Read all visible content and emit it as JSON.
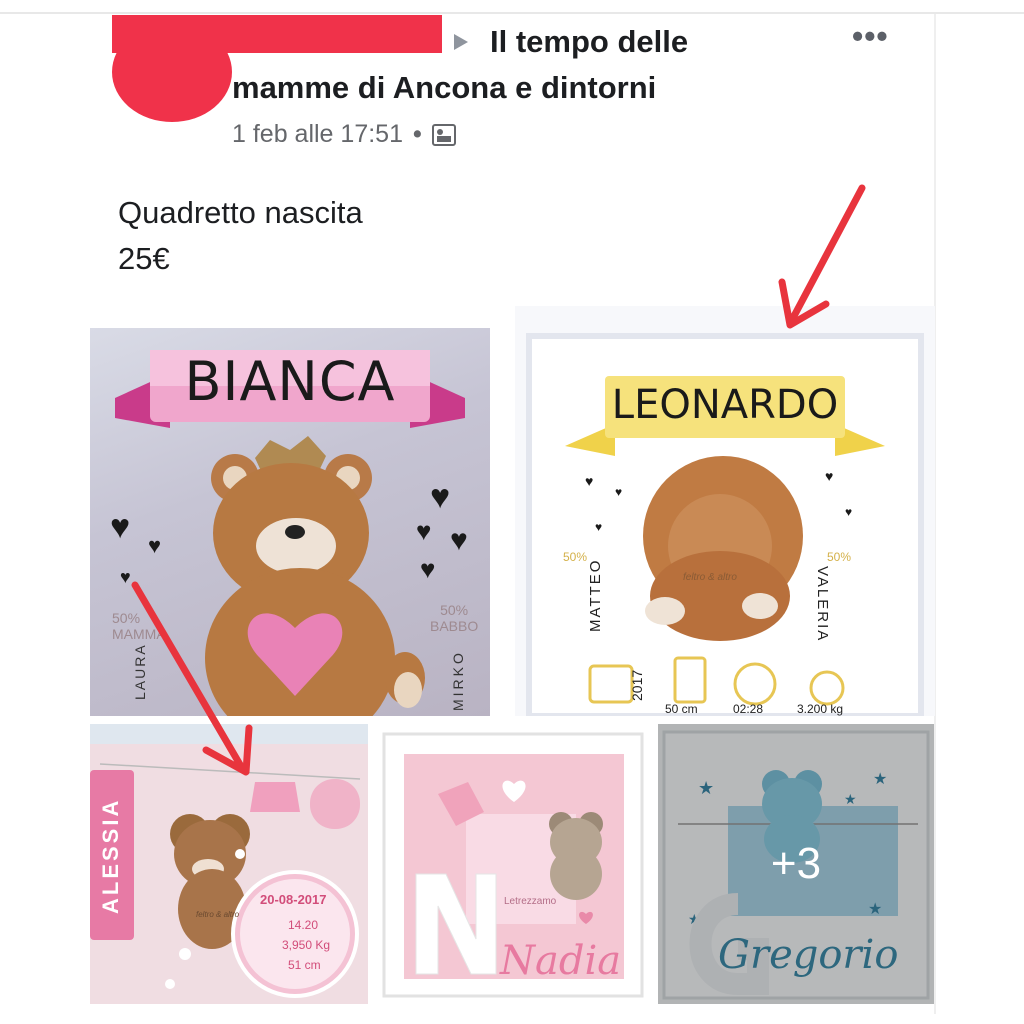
{
  "post": {
    "group_name_line1": "Il tempo delle",
    "group_name_line2": "mamme di Ancona e dintorni",
    "timestamp": "1 feb alle 17:51",
    "separator": "•",
    "audience_icon": "photo-icon",
    "more_icon": "•••",
    "text_line1": "Quadretto nascita",
    "text_line2": "25€"
  },
  "photos": {
    "p1": {
      "name": "BIANCA",
      "left_label": "50%\nMAMMA",
      "left_name": "LAURA",
      "right_label": "50%\nBABBO",
      "right_name": "MIRKO"
    },
    "p2": {
      "name": "LEONARDO",
      "left_pct": "50%",
      "left_name": "MATTEO",
      "right_pct": "50%",
      "right_name": "VALERIA",
      "year": "2017",
      "length": "50 cm",
      "time": "02:28",
      "weight": "3.200 kg",
      "watermark": "feltro & altro"
    },
    "p3": {
      "name": "ALESSIA",
      "date": "20-08-2017",
      "time": "14.20",
      "weight": "3,950 Kg",
      "length": "51 cm",
      "watermark": "feltro & altro"
    },
    "p4": {
      "name": "Nadia",
      "sub": "Letrezzamo"
    },
    "p5": {
      "name": "Gregorio",
      "more_count": "+3"
    }
  },
  "colors": {
    "redaction": "#f0324a",
    "arrow": "#e8343d",
    "pink_ribbon": "#e94f9a",
    "yellow_ribbon": "#f6e27c"
  }
}
